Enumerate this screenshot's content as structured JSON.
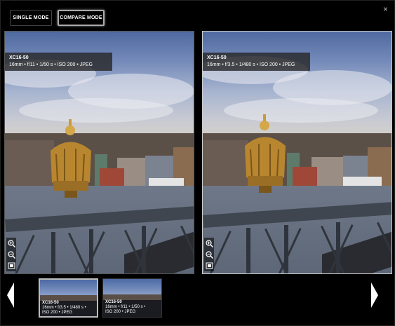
{
  "toolbar": {
    "single_mode_label": "SINGLE MODE",
    "compare_mode_label": "COMPARE MODE",
    "close_glyph": "×"
  },
  "panels": [
    {
      "lens": "XC16-50",
      "settings": "16mm • f/11 • 1/50 s • ISO 200 • JPEG"
    },
    {
      "lens": "XC16-50",
      "settings": "16mm • f/3.5 • 1/480 s • ISO 200 • JPEG"
    }
  ],
  "thumbnails": [
    {
      "lens": "XC16-50",
      "line1": "16mm • f/3.5 • 1/480 s •",
      "line2": "ISO 200 • JPEG",
      "selected": true
    },
    {
      "lens": "XC16-50",
      "line1": "16mm • f/11 • 1/50 s •",
      "line2": "ISO 200 • JPEG",
      "selected": false
    }
  ],
  "icons": {
    "zoom_in": "zoom-in-icon",
    "zoom_out": "zoom-out-icon",
    "fit": "fit-screen-icon",
    "prev": "prev-arrow-icon",
    "next": "next-arrow-icon",
    "close": "close-icon"
  },
  "colors": {
    "background": "#000000",
    "info_box": "#282828",
    "arrow": "#ffffff"
  }
}
